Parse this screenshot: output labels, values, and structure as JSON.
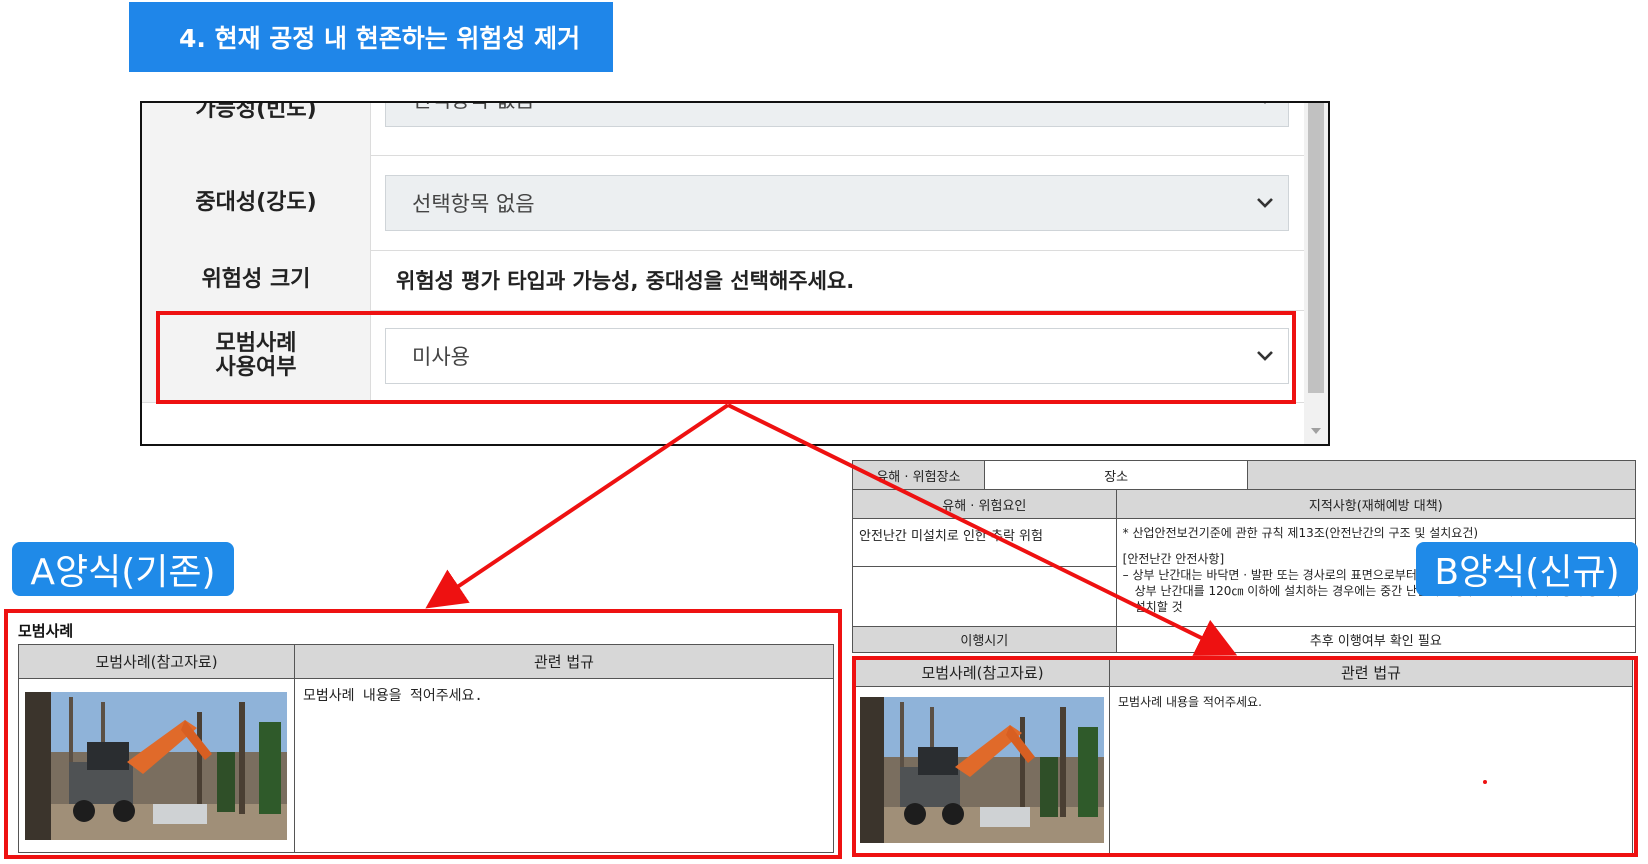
{
  "section_header": {
    "title": "4. 현재 공정 내 현존하는 위험성 제거"
  },
  "form": {
    "rows": [
      {
        "label": "가능성(빈도)",
        "value": "선택항목 없음"
      },
      {
        "label": "중대성(강도)",
        "value": "선택항목 없음"
      },
      {
        "label": "위험성 크기",
        "value": "위험성 평가 타입과 가능성, 중대성을 선택해주세요."
      },
      {
        "label_line1": "모범사례",
        "label_line2": "사용여부",
        "value": "미사용"
      }
    ]
  },
  "badges": {
    "a": "A양식(기존)",
    "b": "B양식(신규)"
  },
  "form_a": {
    "title": "모범사례",
    "col1": "모범사례(참고자료)",
    "col2": "관련 법규",
    "content": "모범사례 내용을 적어주세요."
  },
  "form_b": {
    "hazard_location_label": "유해 · 위험장소",
    "location_label": "장소",
    "hazard_factor_label": "유해 · 위험요인",
    "findings_label": "지적사항(재해예방 대책)",
    "factor_text": "안전난간 미설치로 인한 추락 위험",
    "finding_line1": "* 산업안전보건기준에 관한 규칙 제13조(안전난간의 구조 및 설치요건)",
    "finding_line2": "[안전난간 안전사항]",
    "finding_line3": "– 상부 난간대는 바닥면 · 발판 또는 경사로의 표면으로부터",
    "finding_line4": "상부 난간대를 120㎝ 이하에 설치하는 경우에는 중간 난간대는 상부 난간대와 바닥면등의 중간에 설치할 것",
    "timing_label": "이행시기",
    "timing_value": "추후 이행여부 확인 필요",
    "col1": "모범사례(참고자료)",
    "col2": "관련 법규",
    "content": "모범사례 내용을 적어주세요."
  },
  "colors": {
    "accent": "#1f86e9",
    "highlight": "#ee1111"
  }
}
